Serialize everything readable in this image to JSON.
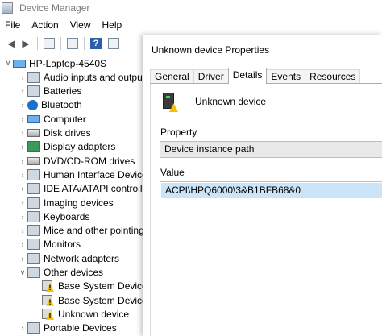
{
  "device_manager": {
    "title": "Device Manager",
    "menu": [
      "File",
      "Action",
      "View",
      "Help"
    ],
    "toolbar": [
      "back-arrow-icon",
      "forward-arrow-icon",
      "properties-icon",
      "update-icon",
      "help-icon",
      "scan-icon"
    ],
    "tree": [
      {
        "label": "HP-Laptop-4540S",
        "level": 0,
        "expander": "v",
        "icon": "computer-icon"
      },
      {
        "label": "Audio inputs and outpu",
        "level": 1,
        "expander": ">",
        "icon": "speaker-icon"
      },
      {
        "label": "Batteries",
        "level": 1,
        "expander": ">",
        "icon": "battery-icon"
      },
      {
        "label": "Bluetooth",
        "level": 1,
        "expander": ">",
        "icon": "bluetooth-icon"
      },
      {
        "label": "Computer",
        "level": 1,
        "expander": ">",
        "icon": "computer-icon"
      },
      {
        "label": "Disk drives",
        "level": 1,
        "expander": ">",
        "icon": "disk-icon"
      },
      {
        "label": "Display adapters",
        "level": 1,
        "expander": ">",
        "icon": "display-adapter-icon"
      },
      {
        "label": "DVD/CD-ROM drives",
        "level": 1,
        "expander": ">",
        "icon": "dvd-icon"
      },
      {
        "label": "Human Interface Device",
        "level": 1,
        "expander": ">",
        "icon": "hid-icon"
      },
      {
        "label": "IDE ATA/ATAPI controlle",
        "level": 1,
        "expander": ">",
        "icon": "ide-icon"
      },
      {
        "label": "Imaging devices",
        "level": 1,
        "expander": ">",
        "icon": "camera-icon"
      },
      {
        "label": "Keyboards",
        "level": 1,
        "expander": ">",
        "icon": "keyboard-icon"
      },
      {
        "label": "Mice and other pointing",
        "level": 1,
        "expander": ">",
        "icon": "mouse-icon"
      },
      {
        "label": "Monitors",
        "level": 1,
        "expander": ">",
        "icon": "monitor-icon"
      },
      {
        "label": "Network adapters",
        "level": 1,
        "expander": ">",
        "icon": "network-icon"
      },
      {
        "label": "Other devices",
        "level": 1,
        "expander": "v",
        "icon": "unknown-device-icon"
      },
      {
        "label": "Base System Device",
        "level": 2,
        "expander": "",
        "icon": "warning-device-icon"
      },
      {
        "label": "Base System Device",
        "level": 2,
        "expander": "",
        "icon": "warning-device-icon"
      },
      {
        "label": "Unknown device",
        "level": 2,
        "expander": "",
        "icon": "warning-device-icon"
      },
      {
        "label": "Portable Devices",
        "level": 1,
        "expander": ">",
        "icon": "portable-device-icon"
      }
    ]
  },
  "dialog": {
    "title": "Unknown device Properties",
    "tabs": [
      "General",
      "Driver",
      "Details",
      "Events",
      "Resources"
    ],
    "active_tab": "Details",
    "device_name": "Unknown device",
    "property_label": "Property",
    "property_value": "Device instance path",
    "value_label": "Value",
    "value": "ACPI\\HPQ6000\\3&B1BFB68&0"
  }
}
